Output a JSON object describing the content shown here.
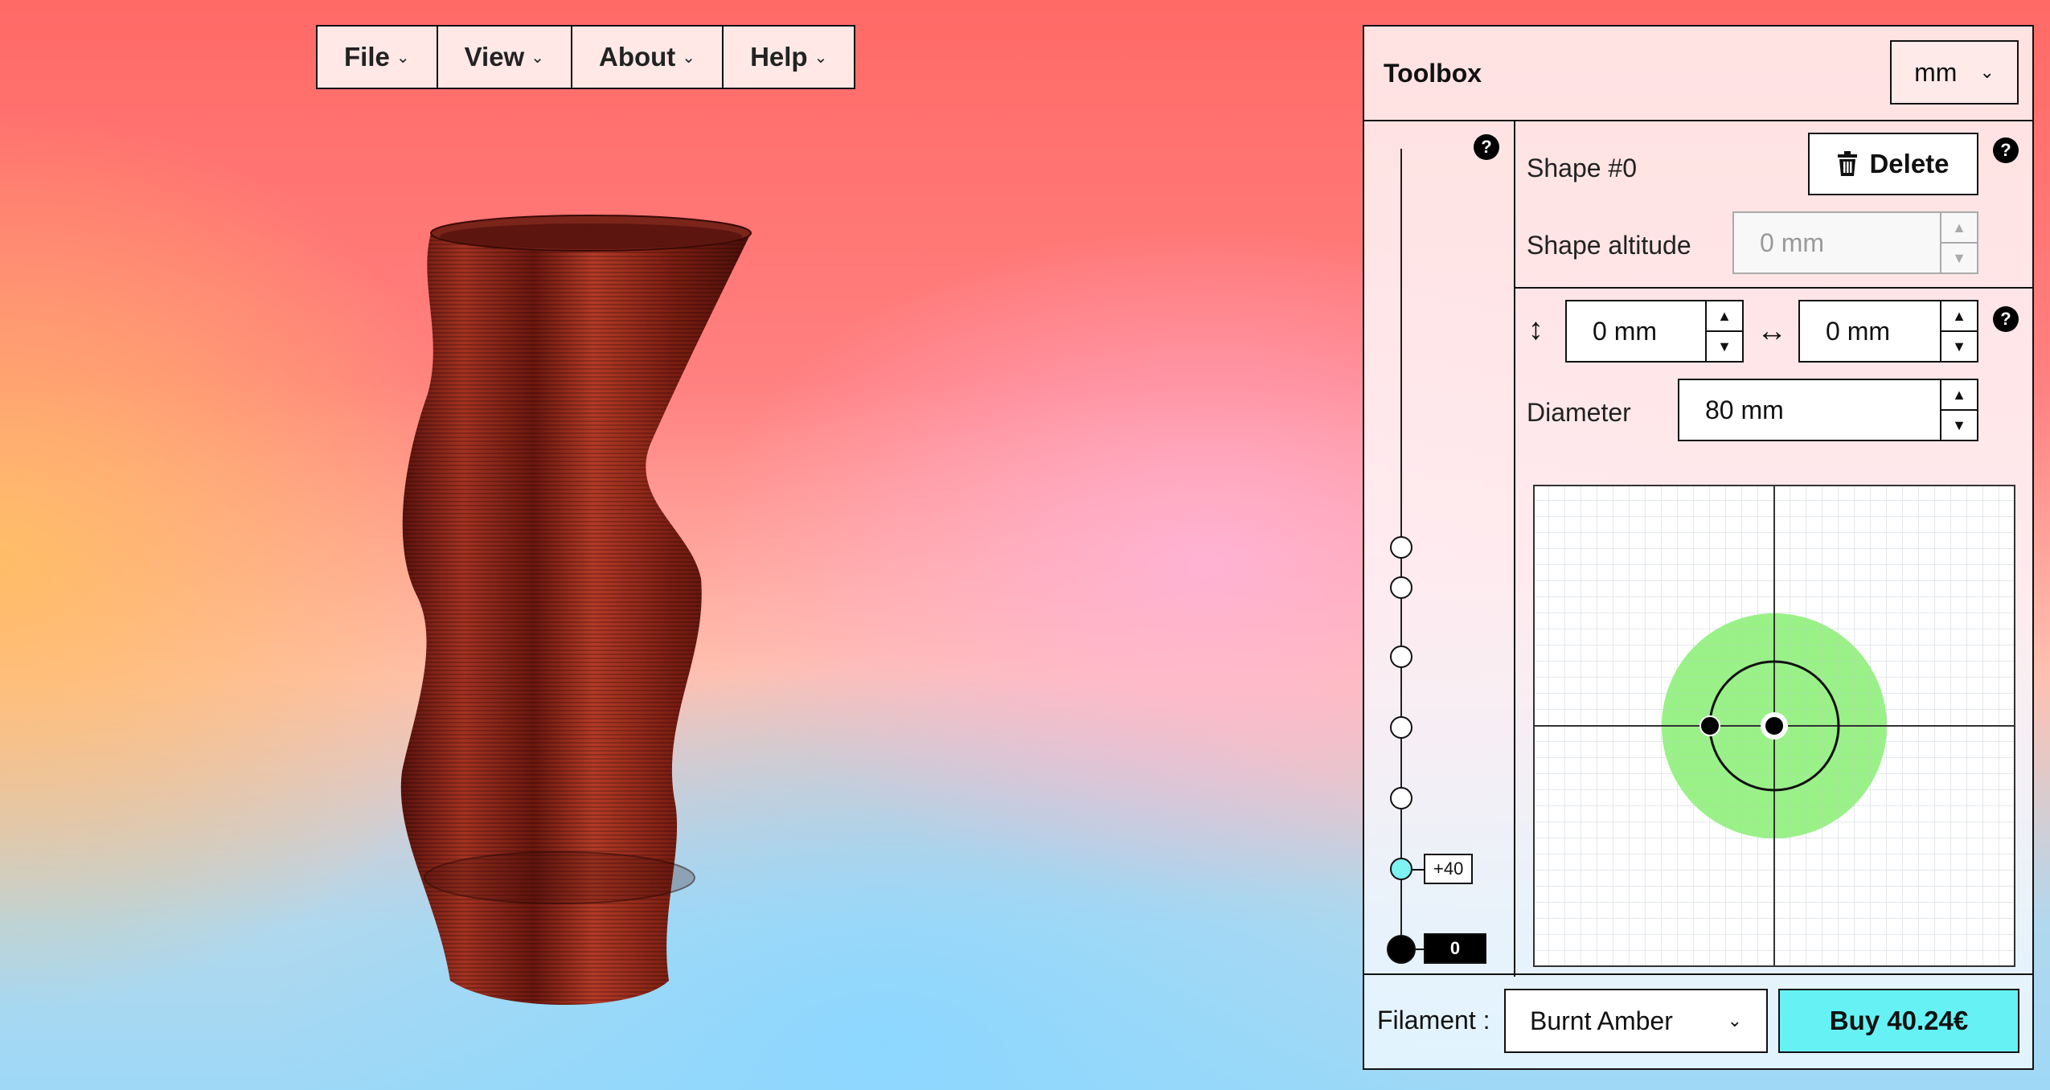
{
  "menu": {
    "items": [
      {
        "label": "File"
      },
      {
        "label": "View"
      },
      {
        "label": "About"
      },
      {
        "label": "Help"
      }
    ]
  },
  "toolbox": {
    "title": "Toolbox",
    "unit": "mm",
    "shape_label": "Shape #0",
    "delete_label": "Delete",
    "altitude_label": "Shape altitude",
    "altitude_value": "0 mm",
    "offset_vertical_value": "0 mm",
    "offset_horizontal_value": "0 mm",
    "diameter_label": "Diameter",
    "diameter_value": "80 mm",
    "help_glyph": "?",
    "slider": {
      "active_label": "+40",
      "base_label": "0"
    },
    "filament_label": "Filament :",
    "filament_value": "Burnt Amber",
    "buy_label": "Buy 40.24€"
  },
  "colors": {
    "vase": "#8a2418",
    "accent": "#66f2f4",
    "grid_disc": "#8ef07a"
  }
}
